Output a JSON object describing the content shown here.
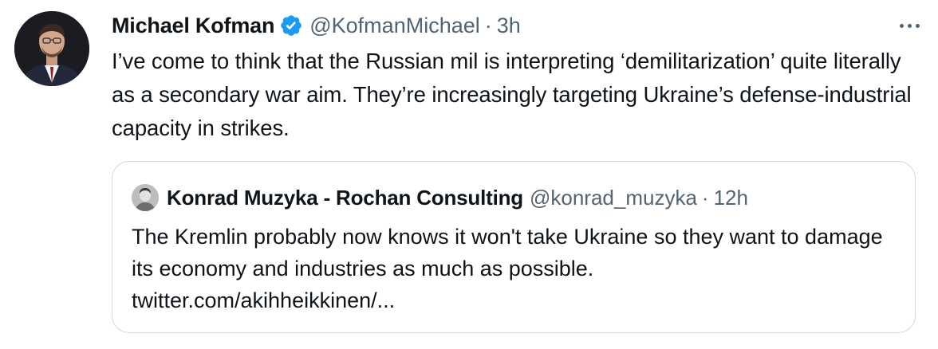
{
  "tweet": {
    "author": {
      "name": "Michael Kofman",
      "handle": "@KofmanMichael",
      "separator": "·",
      "time": "3h",
      "verified": true
    },
    "text": "I’ve come to think that the Russian mil is interpreting ‘demilitarization’ quite literally as a secondary war aim. They’re increasingly targeting Ukraine’s defense-industrial capacity in strikes.",
    "more_icon": "more-horizontal-icon"
  },
  "quote": {
    "author": {
      "name": "Konrad Muzyka - Rochan Consulting",
      "handle": "@konrad_muzyka",
      "separator": "·",
      "time": "12h"
    },
    "text": "The Kremlin probably now knows it won't take Ukraine so they want to damage its economy and industries as much as possible.",
    "link": "twitter.com/akihheikkinen/..."
  },
  "colors": {
    "text_primary": "#0f1419",
    "text_secondary": "#536471",
    "verified_blue": "#1d9bf0",
    "border": "#cfd9de"
  }
}
